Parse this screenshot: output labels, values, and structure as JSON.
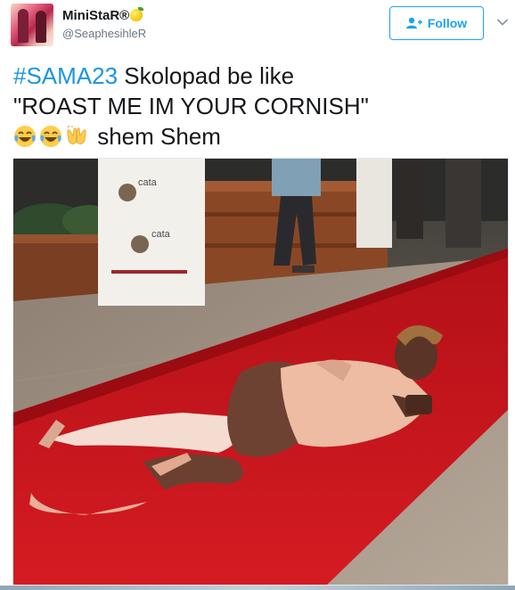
{
  "tweet": {
    "display_name": "MiniStaR®",
    "handle": "@SeaphesihleR",
    "follow_label": "Follow",
    "hashtag": "#SAMA23",
    "line1_rest": " Skolopad be like",
    "line2": "\"ROAST ME IM YOUR CORNISH\"",
    "line3_text": " shem Shem",
    "emojis": [
      "face-with-tears-of-joy-icon",
      "face-with-tears-of-joy-icon",
      "raising-hands-icon"
    ],
    "banner_text_1": "cata",
    "banner_text_2": "cata"
  },
  "colors": {
    "brand_blue": "#1da1f2",
    "link_blue": "#1b95e0",
    "text": "#14171a",
    "muted": "#657786",
    "carpet_red": "#c8141c"
  }
}
